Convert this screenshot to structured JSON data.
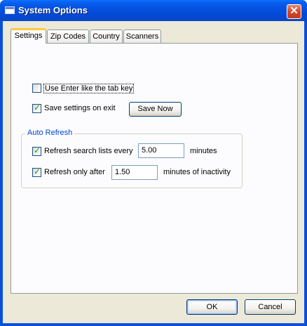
{
  "window": {
    "title": "System Options",
    "close_glyph": "✕"
  },
  "tabs": [
    {
      "label": "Settings",
      "active": true
    },
    {
      "label": "Zip Codes",
      "active": false
    },
    {
      "label": "Country",
      "active": false
    },
    {
      "label": "Scanners",
      "active": false
    }
  ],
  "settings": {
    "use_enter": {
      "label": "Use Enter like the tab key",
      "checked": false
    },
    "save_on_exit": {
      "label": "Save settings on exit",
      "checked": true
    },
    "save_now_label": "Save Now"
  },
  "auto_refresh": {
    "title": "Auto Refresh",
    "refresh_lists": {
      "label": "Refresh search lists every",
      "checked": true,
      "value": "5.00",
      "unit": "minutes"
    },
    "refresh_after": {
      "label": "Refresh only after",
      "checked": true,
      "value": "1.50",
      "unit": "minutes of inactivity"
    }
  },
  "buttons": {
    "ok": "OK",
    "cancel": "Cancel"
  },
  "colors": {
    "title_bar": "#0551e0",
    "focus_tab": "#ffc83c",
    "group_title": "#0046d5"
  }
}
